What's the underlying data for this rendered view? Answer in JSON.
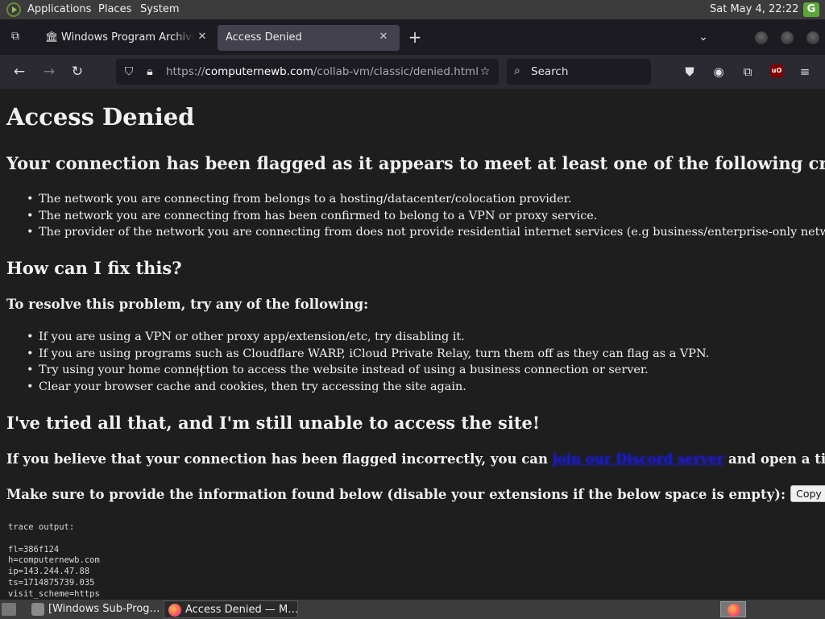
{
  "panel": {
    "menus": [
      "Applications",
      "Places",
      "System"
    ],
    "clock": "Sat May  4, 22:22",
    "tray_letter": "G"
  },
  "tabs": [
    {
      "title": "Windows Program Archive",
      "favicon": "archive-icon",
      "active": false
    },
    {
      "title": "Access Denied",
      "favicon": null,
      "active": true
    }
  ],
  "navbar": {
    "url_prefix": "https://",
    "url_host": "computernewb.com",
    "url_path": "/collab-vm/classic/denied.html",
    "search_placeholder": "Search"
  },
  "page": {
    "h1": "Access Denied",
    "h2_criteria": "Your connection has been flagged as it appears to meet at least one of the following criteria:",
    "criteria": [
      "The network you are connecting from belongs to a hosting/datacenter/colocation provider.",
      "The network you are connecting from has been confirmed to belong to a VPN or proxy service.",
      "The provider of the network you are connecting from does not provide residential internet services (e.g business/enterprise-only networks)."
    ],
    "h2_fix": "How can I fix this?",
    "h3_resolve": "To resolve this problem, try any of the following:",
    "fixes": [
      "If you are using a VPN or other proxy app/extension/etc, try disabling it.",
      "If you are using programs such as Cloudflare WARP, iCloud Private Relay, turn them off as they can flag as a VPN.",
      "Try using your home connection to access the website instead of using a business connection or server.",
      "Clear your browser cache and cookies, then try accessing the site again."
    ],
    "h2_tried": "I've tried all that, and I'm still unable to access the site!",
    "h3_ticket_before": "If you believe that your connection has been flagged incorrectly, you can ",
    "h3_ticket_link": "join our Discord server",
    "h3_ticket_after": " and open a ticket.",
    "h3_info": "Make sure to provide the information found below (disable your extensions if the below space is empty):",
    "copy_button": "Copy to clipboard",
    "trace_lines": [
      "trace output:",
      "",
      "fl=386f124",
      "h=computernewb.com",
      "ip=143.244.47.88",
      "ts=1714875739.035",
      "visit_scheme=https"
    ]
  },
  "taskbar": {
    "tasks": [
      {
        "label": "[Windows Sub-Prog…",
        "icon": "folder-icon",
        "active": false
      },
      {
        "label": "Access Denied — M…",
        "icon": "firefox-icon",
        "active": true
      }
    ]
  }
}
